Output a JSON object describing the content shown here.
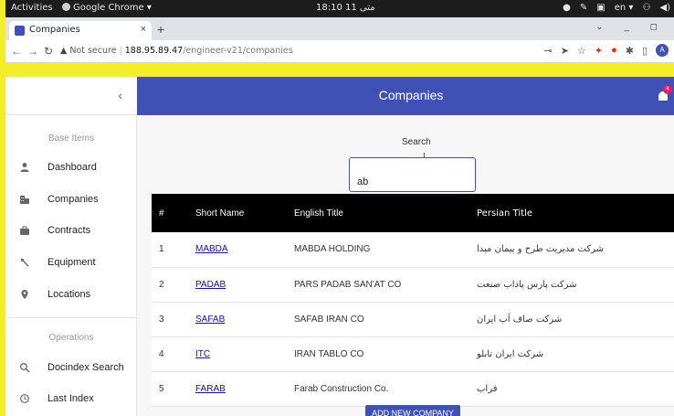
{
  "os": {
    "activities": "Activities",
    "app_menu": "Google Chrome ▾",
    "clock": "18:10 11 متی",
    "lang": "en ▾"
  },
  "browser": {
    "tab_title": "Companies",
    "tab_close": "×",
    "new_tab": "+",
    "not_secure": "Not secure",
    "host": "188.95.89.47",
    "path": "/engineer-v21/companies"
  },
  "app": {
    "header_title": "Companies",
    "collapse_glyph": "‹",
    "notification_count": "4",
    "accent_color": "#3f51b5"
  },
  "sidebar": {
    "base_section": "Base Items",
    "base_items": [
      {
        "label": "Dashboard",
        "icon": "person-icon"
      },
      {
        "label": "Companies",
        "icon": "building-icon"
      },
      {
        "label": "Contracts",
        "icon": "briefcase-icon"
      },
      {
        "label": "Equipment",
        "icon": "wrench-icon"
      },
      {
        "label": "Locations",
        "icon": "location-pin-icon"
      }
    ],
    "ops_section": "Operations",
    "ops_items": [
      {
        "label": "Docindex Search",
        "icon": "search-icon"
      },
      {
        "label": "Last Index",
        "icon": "history-icon"
      }
    ]
  },
  "search": {
    "label": "Search",
    "value": "ab"
  },
  "table": {
    "headers": [
      "#",
      "Short Name",
      "English Title",
      "Persian Title"
    ],
    "rows": [
      {
        "num": "1",
        "short": "MABDA",
        "english": "MABDA HOLDING",
        "persian": "شرکت مدیریت طرح و پیمان مبدا"
      },
      {
        "num": "2",
        "short": "PADAB",
        "english": "PARS PADAB SAN'AT CO",
        "persian": "شرکت پارس پاداب صنعت"
      },
      {
        "num": "3",
        "short": "SAFAB",
        "english": "SAFAB IRAN CO",
        "persian": "شرکت صاف آب ایران"
      },
      {
        "num": "4",
        "short": "ITC",
        "english": "IRAN TABLO CO",
        "persian": "شرکت ایران تابلو"
      },
      {
        "num": "5",
        "short": "FARAB",
        "english": "Farab Construction Co.",
        "persian": "فراب"
      }
    ]
  },
  "add_button": "ADD NEW COMPANY"
}
